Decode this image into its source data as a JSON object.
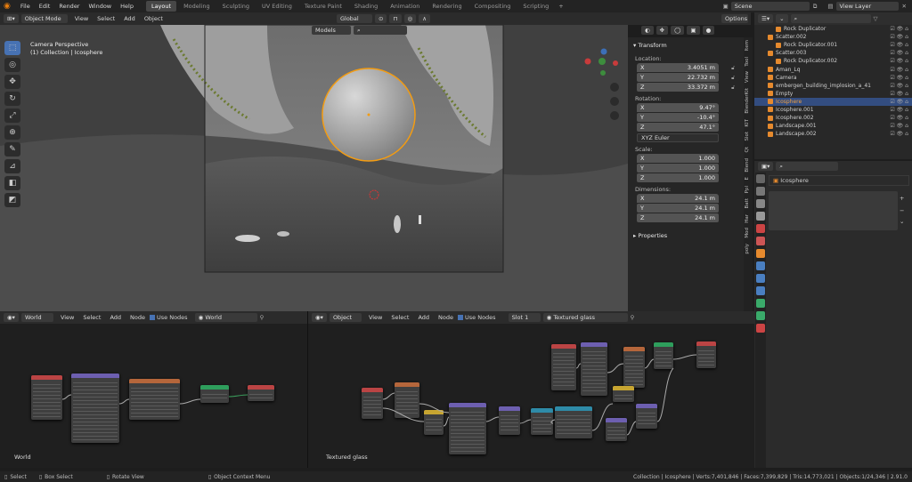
{
  "topbar": {
    "menus": [
      "File",
      "Edit",
      "Render",
      "Window",
      "Help"
    ],
    "workspaces": [
      "Layout",
      "Modeling",
      "Sculpting",
      "UV Editing",
      "Texture Paint",
      "Shading",
      "Animation",
      "Rendering",
      "Compositing",
      "Scripting"
    ],
    "active_workspace": "Layout",
    "scene": "Scene",
    "view_layer": "View Layer"
  },
  "viewport": {
    "mode": "Object Mode",
    "menus": [
      "View",
      "Select",
      "Add",
      "Object"
    ],
    "orientation": "Global",
    "models_label": "Models",
    "options_label": "Options",
    "camera_label": "Camera Perspective",
    "collection_label": "(1) Collection | Icosphere"
  },
  "npanel": {
    "transform_title": "Transform",
    "location_label": "Location:",
    "location": [
      {
        "axis": "X",
        "value": "3.4051 m"
      },
      {
        "axis": "Y",
        "value": "22.732 m"
      },
      {
        "axis": "Z",
        "value": "33.372 m"
      }
    ],
    "rotation_label": "Rotation:",
    "rotation": [
      {
        "axis": "X",
        "value": "9.47°"
      },
      {
        "axis": "Y",
        "value": "-10.4°"
      },
      {
        "axis": "Z",
        "value": "47.1°"
      }
    ],
    "rotation_mode": "XYZ Euler",
    "scale_label": "Scale:",
    "scale": [
      {
        "axis": "X",
        "value": "1.000"
      },
      {
        "axis": "Y",
        "value": "1.000"
      },
      {
        "axis": "Z",
        "value": "1.000"
      }
    ],
    "dimensions_label": "Dimensions:",
    "dimensions": [
      {
        "axis": "X",
        "value": "24.1 m"
      },
      {
        "axis": "Y",
        "value": "24.1 m"
      },
      {
        "axis": "Z",
        "value": "24.1 m"
      }
    ],
    "properties_title": "Properties",
    "tabs": [
      "Item",
      "Tool",
      "View",
      "BlenderKit",
      "KIT",
      "Slot",
      "Qt",
      "Blend",
      "E",
      "Ppl",
      "Batt",
      "Har",
      "Mod",
      "poly"
    ]
  },
  "outliner": {
    "rows": [
      {
        "name": "Rock Duplicator",
        "indent": 2,
        "color": "#e68a2e"
      },
      {
        "name": "Scatter.002",
        "indent": 1,
        "color": "#e68a2e"
      },
      {
        "name": "Rock Duplicator.001",
        "indent": 2,
        "color": "#e68a2e"
      },
      {
        "name": "Scatter.003",
        "indent": 1,
        "color": "#e68a2e"
      },
      {
        "name": "Rock Duplicator.002",
        "indent": 2,
        "color": "#e68a2e"
      },
      {
        "name": "Aman_Lq",
        "indent": 1,
        "color": "#e68a2e"
      },
      {
        "name": "Camera",
        "indent": 1,
        "color": "#e68a2e"
      },
      {
        "name": "embergen_building_implosion_a_41",
        "indent": 1,
        "color": "#e68a2e"
      },
      {
        "name": "Empty",
        "indent": 1,
        "color": "#e68a2e"
      },
      {
        "name": "Icosphere",
        "indent": 1,
        "color": "#e68a2e"
      },
      {
        "name": "Icosphere.001",
        "indent": 1,
        "color": "#e68a2e"
      },
      {
        "name": "Icosphere.002",
        "indent": 1,
        "color": "#e68a2e"
      },
      {
        "name": "Landscape.001",
        "indent": 1,
        "color": "#e68a2e"
      },
      {
        "name": "Landscape.002",
        "indent": 1,
        "color": "#e68a2e"
      }
    ],
    "selected_index": 9
  },
  "properties": {
    "object_name": "Icosphere"
  },
  "node_editor_world": {
    "type_label": "World",
    "menus": [
      "View",
      "Select",
      "Add",
      "Node"
    ],
    "use_nodes_label": "Use Nodes",
    "datablock": "World",
    "corner_label": "World"
  },
  "node_editor_object": {
    "type_label": "Object",
    "menus": [
      "View",
      "Select",
      "Add",
      "Node"
    ],
    "use_nodes_label": "Use Nodes",
    "slot": "Slot 1",
    "material": "Textured glass",
    "corner_label": "Textured glass"
  },
  "status": {
    "select": "Select",
    "box_select": "Box Select",
    "rotate_view": "Rotate View",
    "context_menu": "Object Context Menu",
    "stats": "Collection | Icosphere | Verts:7,401,846 | Faces:7,399,829 | Tris:14,773,021 | Objects:1/24,346 | 2.91.0"
  }
}
